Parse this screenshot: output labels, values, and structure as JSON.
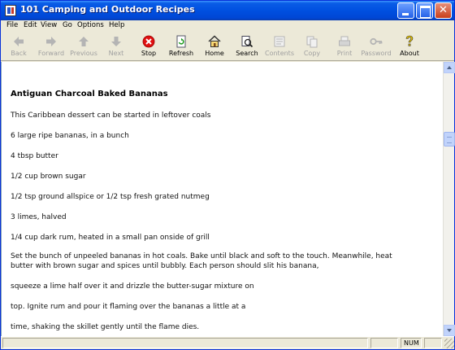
{
  "window": {
    "title": "101 Camping and Outdoor Recipes"
  },
  "menu": [
    "File",
    "Edit",
    "View",
    "Go",
    "Options",
    "Help"
  ],
  "toolbar": [
    {
      "label": "Back",
      "icon": "back-arrow-icon",
      "enabled": false
    },
    {
      "label": "Forward",
      "icon": "forward-arrow-icon",
      "enabled": false
    },
    {
      "label": "Previous",
      "icon": "up-arrow-icon",
      "enabled": false
    },
    {
      "label": "Next",
      "icon": "down-arrow-icon",
      "enabled": false
    },
    {
      "label": "Stop",
      "icon": "stop-icon",
      "enabled": true
    },
    {
      "label": "Refresh",
      "icon": "refresh-icon",
      "enabled": true
    },
    {
      "label": "Home",
      "icon": "home-icon",
      "enabled": true
    },
    {
      "label": "Search",
      "icon": "search-icon",
      "enabled": true
    },
    {
      "label": "Contents",
      "icon": "contents-icon",
      "enabled": false
    },
    {
      "label": "Copy",
      "icon": "copy-icon",
      "enabled": false
    },
    {
      "label": "Print",
      "icon": "print-icon",
      "enabled": false
    },
    {
      "label": "Password",
      "icon": "key-icon",
      "enabled": false
    },
    {
      "label": "About",
      "icon": "about-icon",
      "enabled": true
    }
  ],
  "document": {
    "heading": "Antiguan Charcoal Baked Bananas",
    "paragraphs": [
      "This Caribbean dessert can be started in leftover coals",
      "6 large ripe bananas, in a bunch",
      "4 tbsp butter",
      "1/2 cup brown sugar",
      "1/2 tsp ground allspice or 1/2 tsp fresh grated nutmeg",
      "3 limes, halved",
      "1/4 cup dark rum, heated in a small pan onside of grill",
      "Set the bunch of unpeeled bananas in hot coals. Bake until black and soft to the touch. Meanwhile, heat",
      "butter with brown sugar and spices until bubbly. Each person should slit his banana,",
      "squeeze a lime half over it and drizzle the butter-sugar mixture on",
      "top. Ignite rum and pour it flaming over the bananas a little at a",
      "time, shaking the skillet gently until the flame dies."
    ]
  },
  "statusbar": {
    "num": "NUM"
  },
  "colors": {
    "titlebar": "#0050e0",
    "chrome": "#ece9d8",
    "stop_red": "#e01010"
  }
}
